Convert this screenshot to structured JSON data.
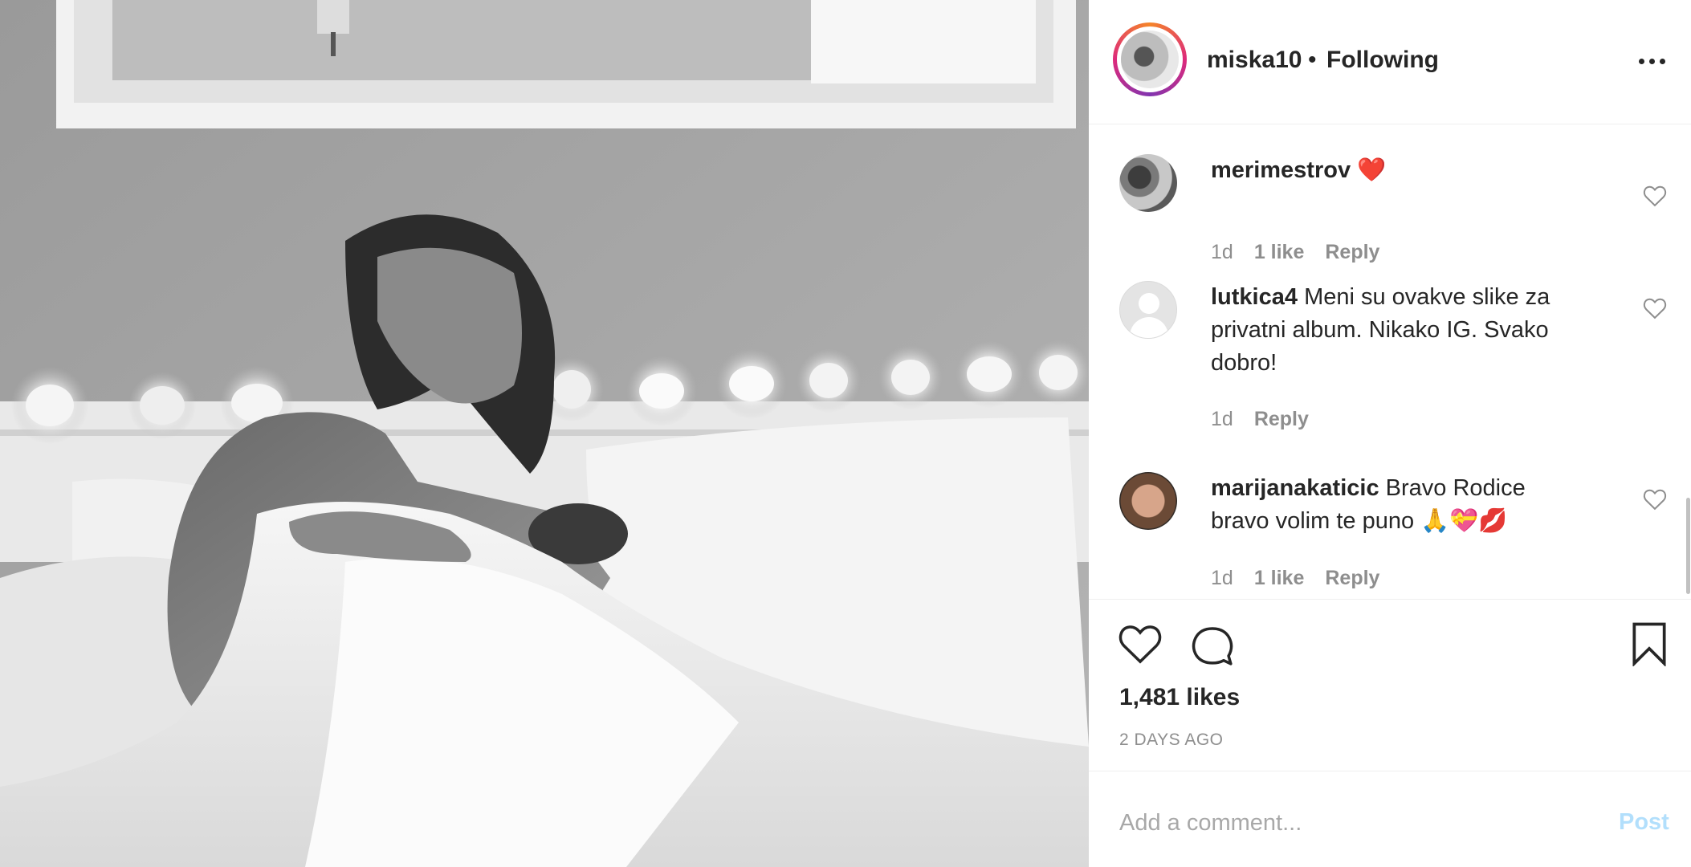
{
  "post": {
    "photo_alt": "",
    "author": {
      "username": "miska10",
      "separator": "•",
      "follow_status": "Following"
    },
    "comments": [
      {
        "username": "merimestrov",
        "text": "",
        "emoji": "❤️",
        "time": "1d",
        "likes": "1 like",
        "reply": "Reply"
      },
      {
        "username": "lutkica4",
        "text": "Meni su ovakve slike za privatni album. Nikako IG. Svako dobro!",
        "time": "1d",
        "reply": "Reply"
      },
      {
        "username": "marijanakaticic",
        "text": "Bravo Rodice bravo volim te puno 🙏💝💋",
        "time": "1d",
        "likes": "1 like",
        "reply": "Reply"
      }
    ],
    "likes": "1,481 likes",
    "posted": "2 DAYS AGO",
    "comment_box": {
      "placeholder": "Add a comment...",
      "post_label": "Post"
    }
  },
  "icons": {
    "like": "heart-outline-icon",
    "comment": "speech-bubble-icon",
    "save": "bookmark-icon",
    "more": "more-horizontal-icon",
    "comment_like": "heart-outline-small-icon"
  },
  "colors": {
    "text": "#262626",
    "secondary": "#8e8e8e",
    "post_disabled": "#b2dffc",
    "border": "#efefef"
  }
}
